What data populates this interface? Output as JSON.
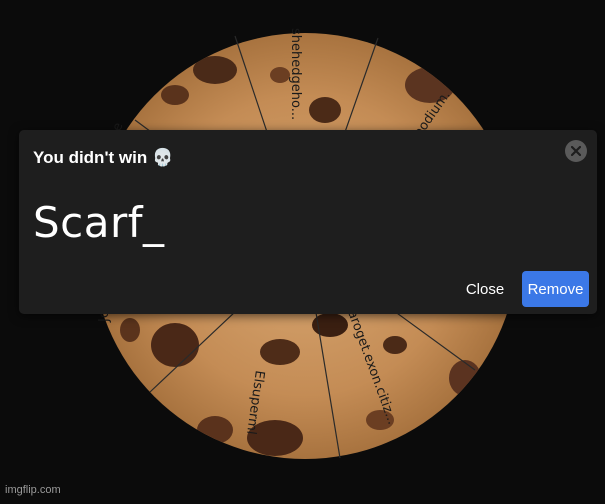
{
  "dialog": {
    "title": "You didn't win",
    "title_icon": "skull-icon",
    "winner_name": "Scarf_",
    "close_label": "Close",
    "remove_label": "Remove",
    "close_x_icon": "close-icon"
  },
  "wheel": {
    "segment_labels": [
      "shehedgeho...",
      "podium.",
      "Jo",
      "aroget.exon.citiz...",
      "Elsuperml",
      "e"
    ]
  },
  "watermark": "imgflip.com",
  "colors": {
    "background": "#0b0b0b",
    "dialog": "#1e1e1e",
    "primary_button": "#3b78e7",
    "cookie": "#c9955f"
  }
}
